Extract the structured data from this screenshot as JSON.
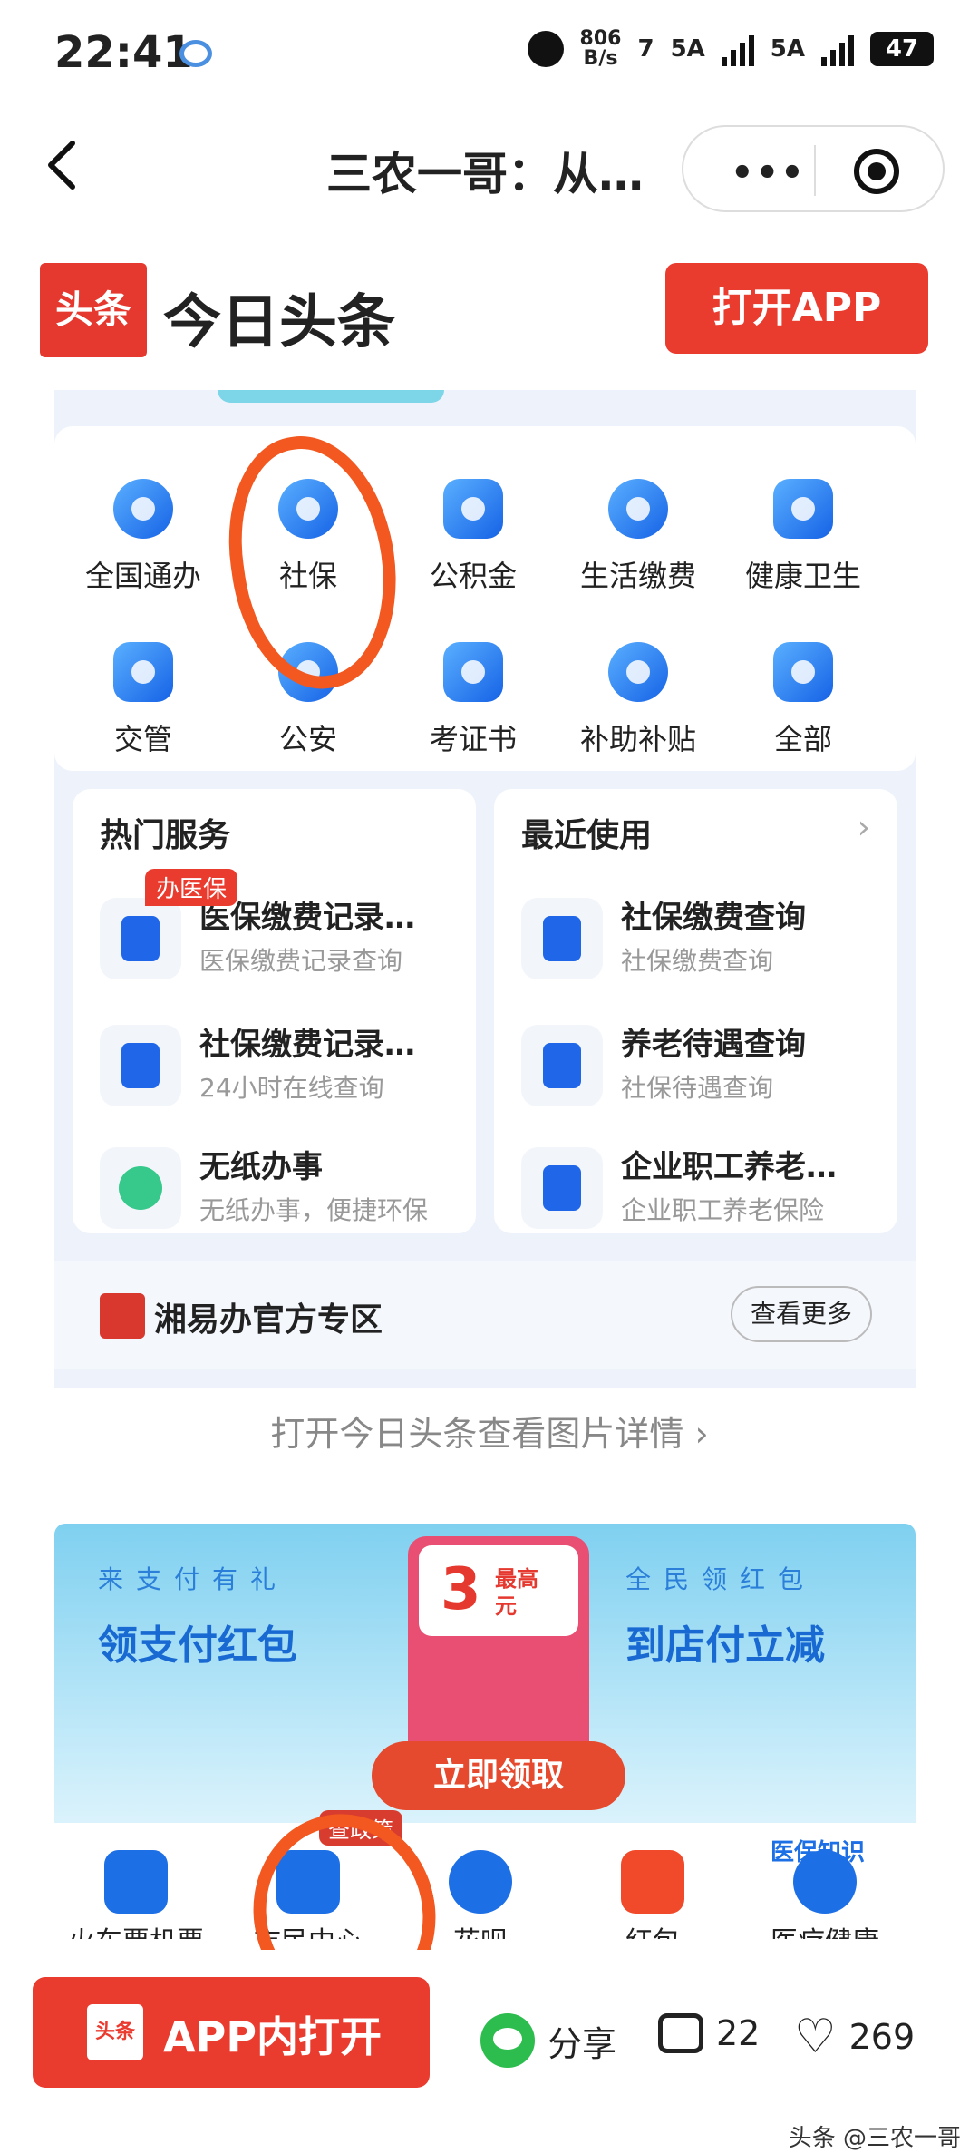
{
  "status_bar": {
    "time": "22:41",
    "net_speed_value": "806",
    "net_speed_unit": "B/s",
    "wifi_label": "7",
    "sim1": "5A",
    "sim2": "5A",
    "battery": "47"
  },
  "nav": {
    "title": "三农一哥：从…",
    "more": "•••"
  },
  "toutiao": {
    "logo_text": "头条",
    "app_name": "今日头条",
    "open_app": "打开APP"
  },
  "services_grid": [
    {
      "label": "全国通办",
      "icon": "globe-icon"
    },
    {
      "label": "社保",
      "icon": "hands-icon"
    },
    {
      "label": "公积金",
      "icon": "house-icon"
    },
    {
      "label": "生活缴费",
      "icon": "bolt-icon"
    },
    {
      "label": "健康卫生",
      "icon": "shield-plus-icon"
    },
    {
      "label": "交管",
      "icon": "car-icon"
    },
    {
      "label": "公安",
      "icon": "police-icon"
    },
    {
      "label": "考证书",
      "icon": "certificate-icon"
    },
    {
      "label": "补助补贴",
      "icon": "money-bag-icon"
    },
    {
      "label": "全部",
      "icon": "grid-icon"
    }
  ],
  "hot_services": {
    "title": "热门服务",
    "tag": "办医保",
    "items": [
      {
        "title": "医保缴费记录…",
        "subtitle": "医保缴费记录查询"
      },
      {
        "title": "社保缴费记录…",
        "subtitle": "24小时在线查询"
      },
      {
        "title": "无纸办事",
        "subtitle": "无纸办事，便捷环保"
      }
    ]
  },
  "recent": {
    "title": "最近使用",
    "items": [
      {
        "title": "社保缴费查询",
        "subtitle": "社保缴费查询"
      },
      {
        "title": "养老待遇查询",
        "subtitle": "社保待遇查询"
      },
      {
        "title": "企业职工养老…",
        "subtitle": "企业职工养老保险"
      }
    ]
  },
  "zone": {
    "title": "湘易办官方专区",
    "more": "查看更多"
  },
  "image_hint": "打开今日头条查看图片详情",
  "ad": {
    "left_sub": "来支付有礼",
    "left_big": "领支付红包",
    "right_sub": "全民领红包",
    "right_big": "到店付立减",
    "amount": "3",
    "amount_cap_1": "最高",
    "amount_cap_2": "元",
    "claim": "立即领取",
    "tag": "查政策",
    "top_label": "医保知识",
    "row": [
      "火车票机票",
      "市民中心",
      "花呗",
      "红包",
      "医疗健康"
    ]
  },
  "bottom": {
    "logo_text": "头条",
    "open_in_app": "APP内打开",
    "share": "分享",
    "comments": "22",
    "likes": "269",
    "watermark": "头条 @三农一哥"
  },
  "colors": {
    "brand_red": "#ea3b2f",
    "primary_blue": "#1f66e8",
    "annotation_orange": "#f2581f"
  }
}
